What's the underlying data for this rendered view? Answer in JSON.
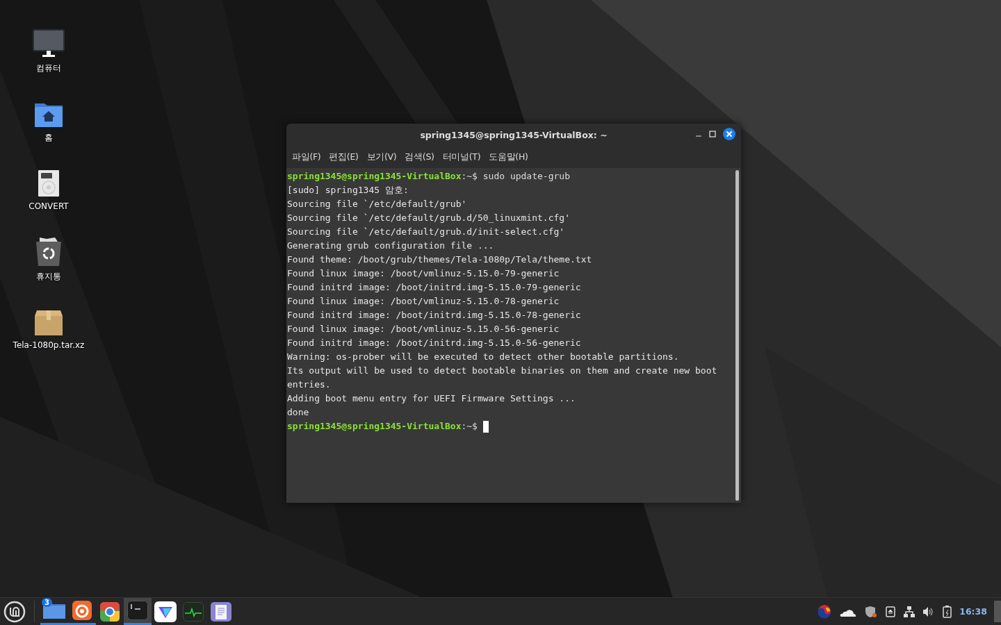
{
  "desktop_icons": [
    {
      "kind": "computer",
      "label": "컴퓨터"
    },
    {
      "kind": "home",
      "label": "홈"
    },
    {
      "kind": "drive",
      "label": "CONVERT"
    },
    {
      "kind": "trash",
      "label": "휴지통"
    },
    {
      "kind": "package",
      "label": "Tela-1080p.tar.xz"
    }
  ],
  "window": {
    "title": "spring1345@spring1345-VirtualBox: ~",
    "menu": [
      "파일(F)",
      "편집(E)",
      "보기(V)",
      "검색(S)",
      "터미널(T)",
      "도움말(H)"
    ],
    "lines": [
      {
        "kind": "prompt",
        "user": "spring1345@spring1345-VirtualBox",
        "path": ":~",
        "command": "$ sudo update-grub"
      },
      {
        "kind": "output",
        "text": "[sudo] spring1345 암호:"
      },
      {
        "kind": "output",
        "text": "Sourcing file `/etc/default/grub'"
      },
      {
        "kind": "output",
        "text": "Sourcing file `/etc/default/grub.d/50_linuxmint.cfg'"
      },
      {
        "kind": "output",
        "text": "Sourcing file `/etc/default/grub.d/init-select.cfg'"
      },
      {
        "kind": "output",
        "text": "Generating grub configuration file ..."
      },
      {
        "kind": "output",
        "text": "Found theme: /boot/grub/themes/Tela-1080p/Tela/theme.txt"
      },
      {
        "kind": "output",
        "text": "Found linux image: /boot/vmlinuz-5.15.0-79-generic"
      },
      {
        "kind": "output",
        "text": "Found initrd image: /boot/initrd.img-5.15.0-79-generic"
      },
      {
        "kind": "output",
        "text": "Found linux image: /boot/vmlinuz-5.15.0-78-generic"
      },
      {
        "kind": "output",
        "text": "Found initrd image: /boot/initrd.img-5.15.0-78-generic"
      },
      {
        "kind": "output",
        "text": "Found linux image: /boot/vmlinuz-5.15.0-56-generic"
      },
      {
        "kind": "output",
        "text": "Found initrd image: /boot/initrd.img-5.15.0-56-generic"
      },
      {
        "kind": "output",
        "text": "Warning: os-prober will be executed to detect other bootable partitions."
      },
      {
        "kind": "output",
        "text": "Its output will be used to detect bootable binaries on them and create new boot"
      },
      {
        "kind": "output",
        "text": "entries."
      },
      {
        "kind": "output",
        "text": "Adding boot menu entry for UEFI Firmware Settings ..."
      },
      {
        "kind": "output",
        "text": "done"
      },
      {
        "kind": "prompt",
        "user": "spring1345@spring1345-VirtualBox",
        "path": ":~",
        "command": "$",
        "cursor": true
      }
    ]
  },
  "taskbar": {
    "launchers": [
      {
        "kind": "files",
        "running": true,
        "active": false,
        "badge": "3"
      },
      {
        "kind": "firefox",
        "running": true,
        "active": false
      },
      {
        "kind": "chrome",
        "running": false,
        "active": false
      },
      {
        "kind": "terminal",
        "running": true,
        "active": true
      },
      {
        "kind": "vpn",
        "running": false,
        "active": false
      },
      {
        "kind": "monitor",
        "running": false,
        "active": false
      },
      {
        "kind": "editor",
        "running": false,
        "active": false
      }
    ],
    "tray": [
      {
        "kind": "keyboard"
      },
      {
        "kind": "cloud"
      },
      {
        "kind": "shield"
      },
      {
        "kind": "removable"
      },
      {
        "kind": "network"
      },
      {
        "kind": "volume"
      },
      {
        "kind": "battery"
      }
    ],
    "clock": "16:38"
  }
}
